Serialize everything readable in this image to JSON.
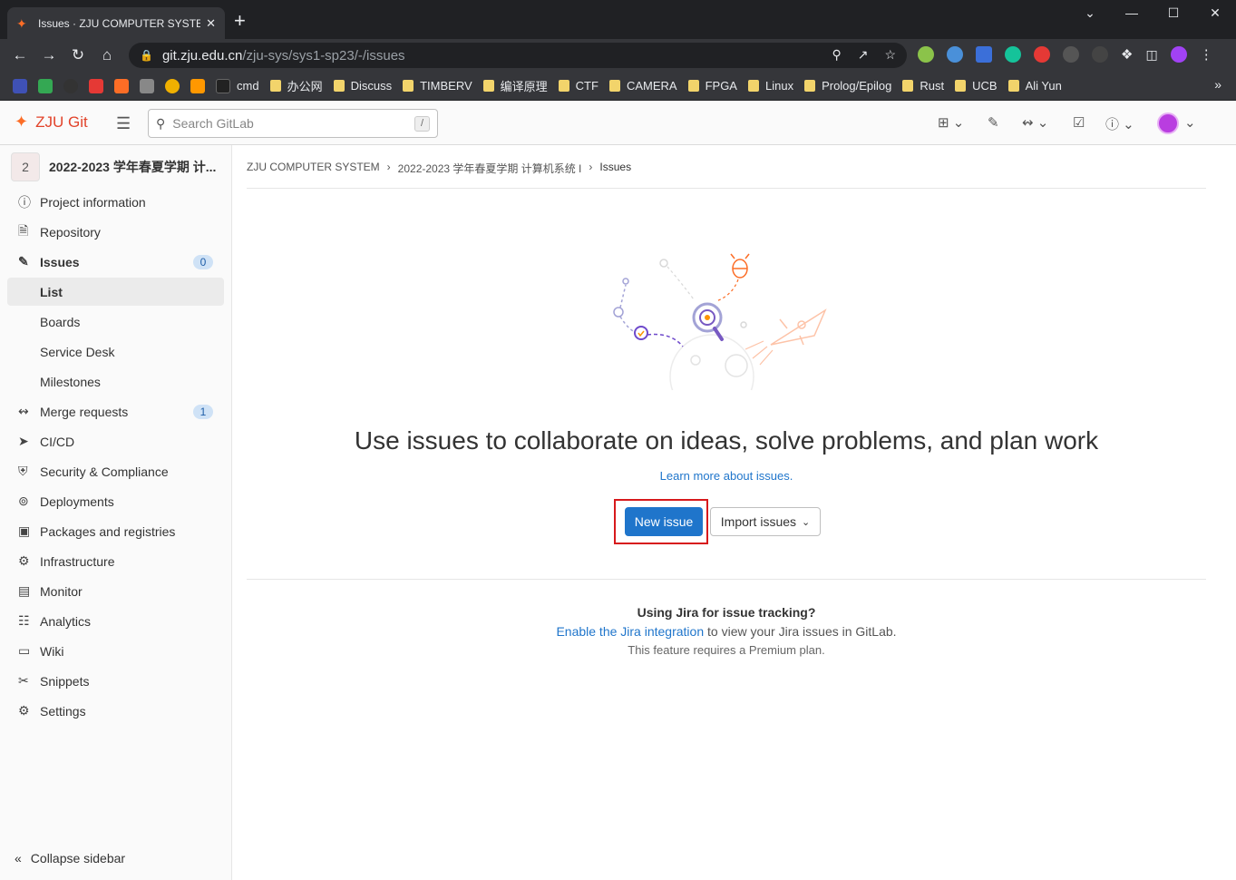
{
  "browser": {
    "tab_title": "Issues · ZJU COMPUTER SYSTE",
    "url_host": "git.zju.edu.cn",
    "url_path": "/zju-sys/sys1-sp23/-/issues",
    "bookmarks": [
      "cmd",
      "办公网",
      "Discuss",
      "TIMBERV",
      "编译原理",
      "CTF",
      "CAMERA",
      "FPGA",
      "Linux",
      "Prolog/Epilog",
      "Rust",
      "UCB",
      "Ali Yun"
    ]
  },
  "header": {
    "brand": "ZJU Git",
    "search_placeholder": "Search GitLab",
    "search_shortcut": "/"
  },
  "sidebar": {
    "project_avatar": "2",
    "project_name": "2022-2023 学年春夏学期 计...",
    "items": [
      {
        "label": "Project information"
      },
      {
        "label": "Repository"
      },
      {
        "label": "Issues",
        "badge": "0"
      },
      {
        "label": "List"
      },
      {
        "label": "Boards"
      },
      {
        "label": "Service Desk"
      },
      {
        "label": "Milestones"
      },
      {
        "label": "Merge requests",
        "badge": "1"
      },
      {
        "label": "CI/CD"
      },
      {
        "label": "Security & Compliance"
      },
      {
        "label": "Deployments"
      },
      {
        "label": "Packages and registries"
      },
      {
        "label": "Infrastructure"
      },
      {
        "label": "Monitor"
      },
      {
        "label": "Analytics"
      },
      {
        "label": "Wiki"
      },
      {
        "label": "Snippets"
      },
      {
        "label": "Settings"
      }
    ],
    "collapse_label": "Collapse sidebar"
  },
  "breadcrumb": [
    "ZJU COMPUTER SYSTEM",
    "2022-2023 学年春夏学期 计算机系统 I",
    "Issues"
  ],
  "main": {
    "headline": "Use issues to collaborate on ideas, solve problems, and plan work",
    "learn_more": "Learn more about issues.",
    "new_issue_label": "New issue",
    "import_issues_label": "Import issues",
    "jira_title": "Using Jira for issue tracking?",
    "jira_link": "Enable the Jira integration",
    "jira_rest": " to view your Jira issues in GitLab.",
    "jira_premium": "This feature requires a Premium plan."
  },
  "colors": {
    "primary": "#1f75cb",
    "brand": "#e2432a",
    "highlight": "#d7191c"
  }
}
